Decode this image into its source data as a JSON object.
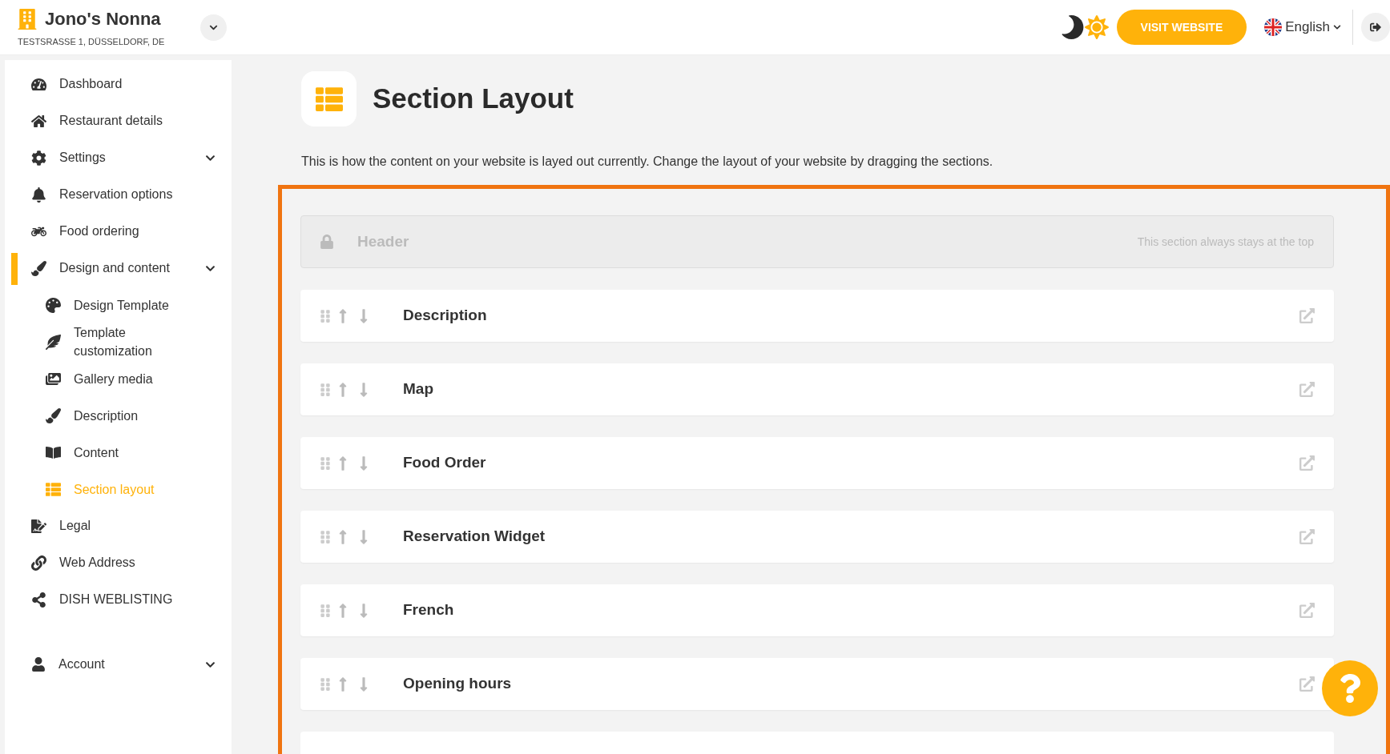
{
  "restaurant": {
    "name": "Jono's Nonna",
    "address": "TESTSRASSE 1, DÜSSELDORF, DE"
  },
  "topbar": {
    "visit_button": "VISIT WEBSITE",
    "language": "English"
  },
  "sidebar": {
    "items": [
      {
        "label": "Dashboard",
        "selected": false
      },
      {
        "label": "Restaurant details",
        "selected": false
      },
      {
        "label": "Settings",
        "selected": false,
        "kind": "group"
      },
      {
        "label": "Reservation options",
        "selected": false
      },
      {
        "label": "Food ordering",
        "selected": false
      },
      {
        "label": "Design and content",
        "selected": true,
        "kind": "group",
        "children": [
          {
            "label": "Design Template",
            "selected": false
          },
          {
            "label": "Template customization",
            "selected": false
          },
          {
            "label": "Gallery media",
            "selected": false
          },
          {
            "label": "Description",
            "selected": false
          },
          {
            "label": "Content",
            "selected": false
          },
          {
            "label": "Section layout",
            "selected": true
          }
        ]
      },
      {
        "label": "Legal",
        "selected": false
      },
      {
        "label": "Web Address",
        "selected": false
      },
      {
        "label": "DISH WEBLISTING",
        "selected": false
      }
    ],
    "account": {
      "label": "Account",
      "kind": "group"
    }
  },
  "page": {
    "title": "Section Layout",
    "description": "This is how the content on your website is layed out currently. Change the layout of your website by dragging the sections."
  },
  "fixed_section": {
    "label": "Header",
    "note": "This section always stays at the top"
  },
  "sections": [
    {
      "label": "Description"
    },
    {
      "label": "Map"
    },
    {
      "label": "Food Order"
    },
    {
      "label": "Reservation Widget"
    },
    {
      "label": "French"
    },
    {
      "label": "Opening hours"
    }
  ]
}
